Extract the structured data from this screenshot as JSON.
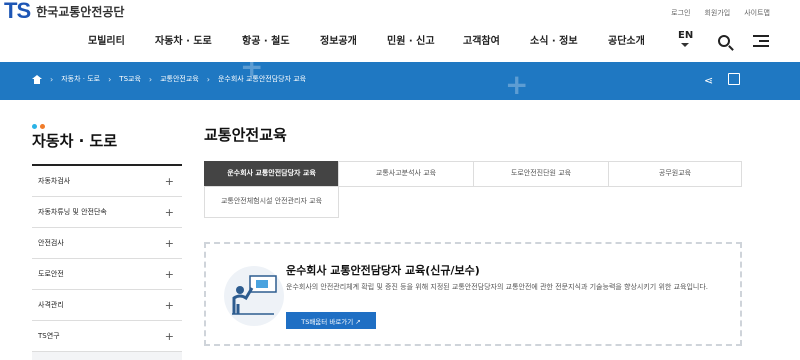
{
  "header": {
    "logo_mark": "TS",
    "logo_text": "한국교통안전공단",
    "util_links": [
      "로그인",
      "회원가입",
      "사이트맵"
    ],
    "gnb": [
      "모빌리티",
      "자동차 · 도로",
      "항공 · 철도",
      "정보공개",
      "민원 · 신고",
      "고객참여",
      "소식 · 정보",
      "공단소개"
    ],
    "lang": "EN",
    "icons": [
      "search-icon",
      "hamburger-menu-icon"
    ]
  },
  "band": {
    "color": "#1f78c2",
    "breadcrumb": [
      "자동차 · 도로",
      "TS교육",
      "교통안전교육",
      "운수회사 교통안전담당자 교육"
    ]
  },
  "sidebar": {
    "title": "자동차 · 도로",
    "dot_colors": [
      "#2bb3e6",
      "#f07c2a"
    ],
    "items": [
      {
        "label": "자동차검사"
      },
      {
        "label": "자동차튜닝 및 안전단속"
      },
      {
        "label": "안전검사"
      },
      {
        "label": "도로안전"
      },
      {
        "label": "사격관리"
      },
      {
        "label": "TS연구"
      }
    ]
  },
  "main": {
    "title": "교통안전교육",
    "tabs": [
      {
        "label": "운수회사 교통안전담당자 교육",
        "active": true
      },
      {
        "label": "교통사고분석사 교육",
        "active": false
      },
      {
        "label": "도로안전진단원 교육",
        "active": false
      },
      {
        "label": "공무원교육",
        "active": false
      },
      {
        "label": "교통안전체험시설 안전관리자 교육",
        "active": false
      }
    ],
    "card": {
      "title": "운수회사 교통안전담당자 교육(신규/보수)",
      "desc": "운수회사의 안전관리체계 확립 및 증진 등을 위해 지정된 교통안전담당자의 교통안전에 관한 전문지식과 기술능력을 향상시키기 위한 교육입니다.",
      "button": "TS배움터 바로가기 ↗",
      "accent": "#1f6fc4"
    }
  }
}
